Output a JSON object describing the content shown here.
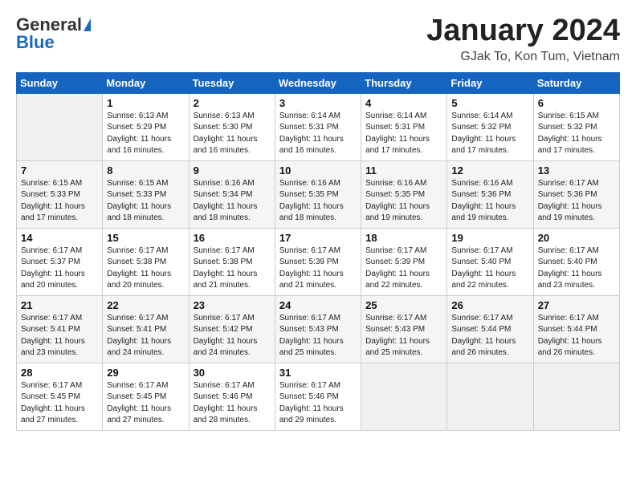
{
  "header": {
    "logo_general": "General",
    "logo_blue": "Blue",
    "month_title": "January 2024",
    "location": "GJak To, Kon Tum, Vietnam"
  },
  "days_of_week": [
    "Sunday",
    "Monday",
    "Tuesday",
    "Wednesday",
    "Thursday",
    "Friday",
    "Saturday"
  ],
  "weeks": [
    [
      {
        "day": "",
        "sunrise": "",
        "sunset": "",
        "daylight": "",
        "empty": true
      },
      {
        "day": "1",
        "sunrise": "6:13 AM",
        "sunset": "5:29 PM",
        "daylight": "11 hours and 16 minutes."
      },
      {
        "day": "2",
        "sunrise": "6:13 AM",
        "sunset": "5:30 PM",
        "daylight": "11 hours and 16 minutes."
      },
      {
        "day": "3",
        "sunrise": "6:14 AM",
        "sunset": "5:31 PM",
        "daylight": "11 hours and 16 minutes."
      },
      {
        "day": "4",
        "sunrise": "6:14 AM",
        "sunset": "5:31 PM",
        "daylight": "11 hours and 17 minutes."
      },
      {
        "day": "5",
        "sunrise": "6:14 AM",
        "sunset": "5:32 PM",
        "daylight": "11 hours and 17 minutes."
      },
      {
        "day": "6",
        "sunrise": "6:15 AM",
        "sunset": "5:32 PM",
        "daylight": "11 hours and 17 minutes."
      }
    ],
    [
      {
        "day": "7",
        "sunrise": "6:15 AM",
        "sunset": "5:33 PM",
        "daylight": "11 hours and 17 minutes."
      },
      {
        "day": "8",
        "sunrise": "6:15 AM",
        "sunset": "5:33 PM",
        "daylight": "11 hours and 18 minutes."
      },
      {
        "day": "9",
        "sunrise": "6:16 AM",
        "sunset": "5:34 PM",
        "daylight": "11 hours and 18 minutes."
      },
      {
        "day": "10",
        "sunrise": "6:16 AM",
        "sunset": "5:35 PM",
        "daylight": "11 hours and 18 minutes."
      },
      {
        "day": "11",
        "sunrise": "6:16 AM",
        "sunset": "5:35 PM",
        "daylight": "11 hours and 19 minutes."
      },
      {
        "day": "12",
        "sunrise": "6:16 AM",
        "sunset": "5:36 PM",
        "daylight": "11 hours and 19 minutes."
      },
      {
        "day": "13",
        "sunrise": "6:17 AM",
        "sunset": "5:36 PM",
        "daylight": "11 hours and 19 minutes."
      }
    ],
    [
      {
        "day": "14",
        "sunrise": "6:17 AM",
        "sunset": "5:37 PM",
        "daylight": "11 hours and 20 minutes."
      },
      {
        "day": "15",
        "sunrise": "6:17 AM",
        "sunset": "5:38 PM",
        "daylight": "11 hours and 20 minutes."
      },
      {
        "day": "16",
        "sunrise": "6:17 AM",
        "sunset": "5:38 PM",
        "daylight": "11 hours and 21 minutes."
      },
      {
        "day": "17",
        "sunrise": "6:17 AM",
        "sunset": "5:39 PM",
        "daylight": "11 hours and 21 minutes."
      },
      {
        "day": "18",
        "sunrise": "6:17 AM",
        "sunset": "5:39 PM",
        "daylight": "11 hours and 22 minutes."
      },
      {
        "day": "19",
        "sunrise": "6:17 AM",
        "sunset": "5:40 PM",
        "daylight": "11 hours and 22 minutes."
      },
      {
        "day": "20",
        "sunrise": "6:17 AM",
        "sunset": "5:40 PM",
        "daylight": "11 hours and 23 minutes."
      }
    ],
    [
      {
        "day": "21",
        "sunrise": "6:17 AM",
        "sunset": "5:41 PM",
        "daylight": "11 hours and 23 minutes."
      },
      {
        "day": "22",
        "sunrise": "6:17 AM",
        "sunset": "5:41 PM",
        "daylight": "11 hours and 24 minutes."
      },
      {
        "day": "23",
        "sunrise": "6:17 AM",
        "sunset": "5:42 PM",
        "daylight": "11 hours and 24 minutes."
      },
      {
        "day": "24",
        "sunrise": "6:17 AM",
        "sunset": "5:43 PM",
        "daylight": "11 hours and 25 minutes."
      },
      {
        "day": "25",
        "sunrise": "6:17 AM",
        "sunset": "5:43 PM",
        "daylight": "11 hours and 25 minutes."
      },
      {
        "day": "26",
        "sunrise": "6:17 AM",
        "sunset": "5:44 PM",
        "daylight": "11 hours and 26 minutes."
      },
      {
        "day": "27",
        "sunrise": "6:17 AM",
        "sunset": "5:44 PM",
        "daylight": "11 hours and 26 minutes."
      }
    ],
    [
      {
        "day": "28",
        "sunrise": "6:17 AM",
        "sunset": "5:45 PM",
        "daylight": "11 hours and 27 minutes."
      },
      {
        "day": "29",
        "sunrise": "6:17 AM",
        "sunset": "5:45 PM",
        "daylight": "11 hours and 27 minutes."
      },
      {
        "day": "30",
        "sunrise": "6:17 AM",
        "sunset": "5:46 PM",
        "daylight": "11 hours and 28 minutes."
      },
      {
        "day": "31",
        "sunrise": "6:17 AM",
        "sunset": "5:46 PM",
        "daylight": "11 hours and 29 minutes."
      },
      {
        "day": "",
        "sunrise": "",
        "sunset": "",
        "daylight": "",
        "empty": true
      },
      {
        "day": "",
        "sunrise": "",
        "sunset": "",
        "daylight": "",
        "empty": true
      },
      {
        "day": "",
        "sunrise": "",
        "sunset": "",
        "daylight": "",
        "empty": true
      }
    ]
  ],
  "labels": {
    "sunrise_prefix": "Sunrise: ",
    "sunset_prefix": "Sunset: ",
    "daylight_prefix": "Daylight: "
  }
}
